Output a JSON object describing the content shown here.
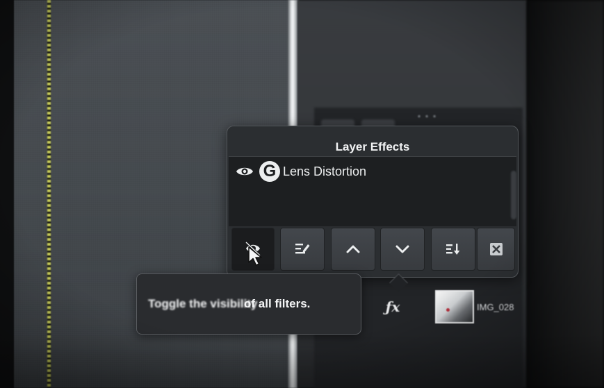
{
  "panel": {
    "title": "Layer Effects",
    "effects": [
      {
        "name": "Lens Distortion",
        "visible": true,
        "icon": "gmic-logo-icon"
      }
    ]
  },
  "toolbar": {
    "buttons": [
      {
        "id": "toggle-visibility",
        "icon": "eye-toggle-icon"
      },
      {
        "id": "edit",
        "icon": "edit-icon"
      },
      {
        "id": "move-up",
        "icon": "chevron-up-icon"
      },
      {
        "id": "move-down",
        "icon": "chevron-down-icon"
      },
      {
        "id": "sort",
        "icon": "sort-icon"
      },
      {
        "id": "delete",
        "icon": "delete-icon"
      }
    ]
  },
  "tooltip": {
    "text_blurred": "Toggle the visibility",
    "text_sharp": "of all filters."
  },
  "layer": {
    "fx_label": "ƒx",
    "name": "IMG_028"
  },
  "colors": {
    "panel_bg": "#2b2e31",
    "list_bg": "#1d1f21",
    "text": "#f1f2f3",
    "selection_edge": "#cfd35a"
  }
}
